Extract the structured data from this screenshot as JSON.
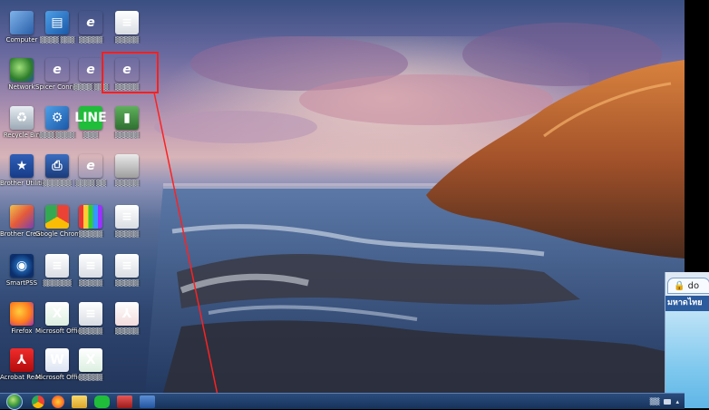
{
  "desktop": {
    "icons": [
      {
        "id": "computer",
        "label": "Computer",
        "glyph": "",
        "icon": "computer-icon"
      },
      {
        "id": "network",
        "label": "Network",
        "glyph": "",
        "icon": "network-icon"
      },
      {
        "id": "recycle",
        "label": "Recycle Bin",
        "glyph": "",
        "icon": "recycle-bin-icon"
      },
      {
        "id": "brother-util",
        "label": "Brother Utilities",
        "glyph": "",
        "icon": "brother-utilities-icon"
      },
      {
        "id": "brother-crea",
        "label": "Brother Creati...",
        "glyph": "",
        "icon": "brother-creative-icon"
      },
      {
        "id": "smartpss",
        "label": "SmartPSS",
        "glyph": "",
        "icon": "smartpss-icon"
      },
      {
        "id": "firefox",
        "label": "Firefox",
        "glyph": "",
        "icon": "firefox-icon"
      },
      {
        "id": "acrobat",
        "label": "Acrobat Reader DC",
        "glyph": "",
        "icon": "acrobat-icon"
      }
    ],
    "col2": [
      {
        "label": "",
        "icon": "app-icon"
      },
      {
        "label": "Spicer Connect Site",
        "icon": "ie-shortcut-icon"
      },
      {
        "label": "",
        "icon": "settings-app-icon"
      },
      {
        "label": "",
        "icon": "printer-app-icon"
      },
      {
        "label": "Google Chrome",
        "icon": "chrome-icon"
      },
      {
        "label": "",
        "icon": "document-icon"
      },
      {
        "label": "Microsoft Office Exc...",
        "icon": "excel-icon"
      },
      {
        "label": "Microsoft Office Wo...",
        "icon": "word-icon"
      }
    ],
    "col3": [
      {
        "label": "",
        "icon": "ie-icon"
      },
      {
        "label": "",
        "icon": "ie-shortcut-icon"
      },
      {
        "label": "LINE",
        "icon": "line-icon"
      },
      {
        "label": "",
        "icon": "ie-shortcut-icon"
      },
      {
        "label": "",
        "icon": "books-icon"
      },
      {
        "label": "",
        "icon": "document-icon"
      },
      {
        "label": "",
        "icon": "document-icon"
      },
      {
        "label": "",
        "icon": "excel-icon"
      }
    ],
    "col4": [
      {
        "label": "",
        "icon": "document-icon"
      },
      {
        "label": "",
        "icon": "ie-highlighted-icon"
      },
      {
        "label": "",
        "icon": "green-app-icon"
      },
      {
        "label": "",
        "icon": "scanner-icon"
      },
      {
        "label": "",
        "icon": "document-icon"
      },
      {
        "label": "",
        "icon": "document-icon"
      },
      {
        "label": "",
        "icon": "pdf-icon"
      }
    ]
  },
  "taskbar": {
    "items": [
      "start",
      "chrome",
      "firefox",
      "folder",
      "line",
      "app",
      "window"
    ]
  },
  "browser": {
    "tab_text": "do",
    "header_text": "มหาดไทย"
  },
  "colors": {
    "highlight": "#ff2020",
    "taskbar": "#1f3f6b"
  }
}
